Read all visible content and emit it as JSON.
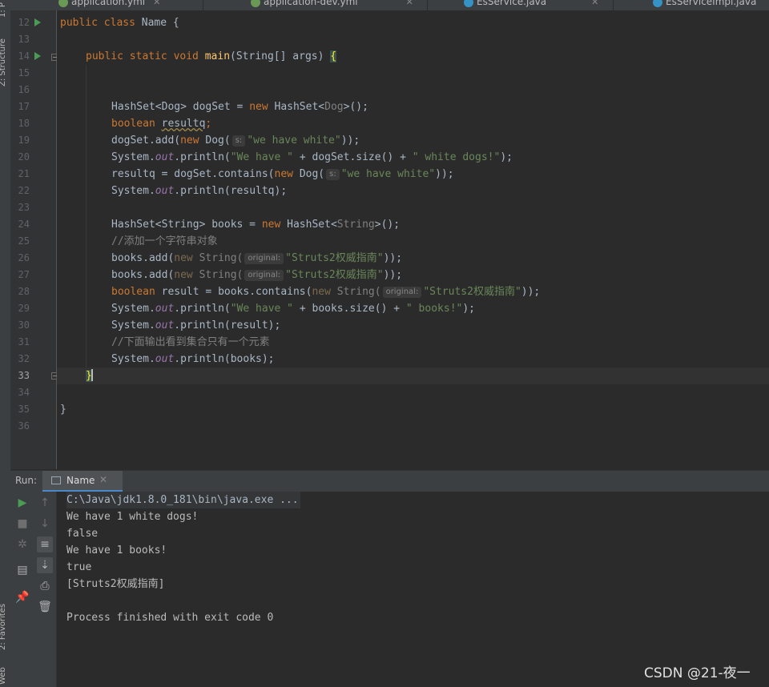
{
  "sidebar": {
    "project_label": "1: P",
    "structure_label": "Z: Structure",
    "favorites_label": "2: Favorites",
    "web_label": "Web"
  },
  "tabs": [
    {
      "label": "application.yml",
      "icon_color": "#6a9955"
    },
    {
      "label": "application-dev.yml",
      "icon_color": "#6a9955"
    },
    {
      "label": "EsService.java",
      "icon_color": "#3592c4"
    },
    {
      "label": "EsServiceImpl.java",
      "icon_color": "#3592c4"
    }
  ],
  "editor": {
    "line_numbers": [
      "12",
      "13",
      "14",
      "15",
      "16",
      "17",
      "18",
      "19",
      "20",
      "21",
      "22",
      "23",
      "24",
      "25",
      "26",
      "27",
      "28",
      "29",
      "30",
      "31",
      "32",
      "33",
      "34",
      "35",
      "36"
    ],
    "current_line": "33",
    "code": {
      "l12_kw": "public class ",
      "l12_rest": "Name {",
      "l14_kw": "public static void ",
      "l14_fn": "main",
      "l14_rest": "(String[] args) ",
      "l14_brace": "{",
      "l17_a": "HashSet<Dog> dogSet = ",
      "l17_kw": "new ",
      "l17_b": "HashSet<",
      "l17_gen": "Dog",
      "l17_c": ">();",
      "l18_kw": "boolean ",
      "l18_var": "resultq",
      "l18_end": ";",
      "l19_a": "dogSet.add(",
      "l19_kw": "new ",
      "l19_b": "Dog(",
      "l19_hint": "s:",
      "l19_str": "\"we have white\"",
      "l19_c": "));",
      "l20_a": "System.",
      "l20_out": "out",
      "l20_b": ".println(",
      "l20_s1": "\"We have \"",
      "l20_c": " + dogSet.size() + ",
      "l20_s2": "\" white dogs!\"",
      "l20_d": ");",
      "l21_a": "resultq = dogSet.contains(",
      "l21_kw": "new ",
      "l21_b": "Dog(",
      "l21_hint": "s:",
      "l21_str": "\"we have white\"",
      "l21_c": "));",
      "l22_a": "System.",
      "l22_out": "out",
      "l22_b": ".println(resultq);",
      "l24_a": "HashSet<String> books = ",
      "l24_kw": "new ",
      "l24_b": "HashSet<",
      "l24_gen": "String",
      "l24_c": ">();",
      "l25_cm": "//添加一个字符串对象",
      "l26_a": "books.add(",
      "l26_kw": "new ",
      "l26_b": "String(",
      "l26_hint": "original:",
      "l26_str": "\"Struts2权威指南\"",
      "l26_c": "));",
      "l27_a": "books.add(",
      "l27_kw": "new ",
      "l27_b": "String(",
      "l27_hint": "original:",
      "l27_str": "\"Struts2权威指南\"",
      "l27_c": "));",
      "l28_kw1": "boolean ",
      "l28_a": "result = books.contains(",
      "l28_kw2": "new ",
      "l28_b": "String(",
      "l28_hint": "original:",
      "l28_str": "\"Struts2权威指南\"",
      "l28_c": "));",
      "l29_a": "System.",
      "l29_out": "out",
      "l29_b": ".println(",
      "l29_s1": "\"We have \"",
      "l29_c": " + books.size() + ",
      "l29_s2": "\" books!\"",
      "l29_d": ");",
      "l30_a": "System.",
      "l30_out": "out",
      "l30_b": ".println(result);",
      "l31_cm": "//下面输出看到集合只有一个元素",
      "l32_a": "System.",
      "l32_out": "out",
      "l32_b": ".println(books);",
      "l33_brace": "}",
      "l35": "}"
    }
  },
  "run_panel": {
    "label": "Run:",
    "tab_name": "Name",
    "tab_close": "✕",
    "output": [
      "C:\\Java\\jdk1.8.0_181\\bin\\java.exe ...",
      "We have 1 white dogs!",
      "false",
      "We have 1 books!",
      "true",
      "[Struts2权威指南]",
      "",
      "Process finished with exit code 0"
    ]
  },
  "icons": {
    "rerun": "play-icon",
    "stop": "stop-icon",
    "up": "arrow-up-icon",
    "down": "arrow-down-icon",
    "wrap": "soft-wrap-icon",
    "scroll_end": "scroll-to-end-icon",
    "print": "print-icon",
    "trash": "trash-icon",
    "pin": "pin-icon",
    "layout": "layout-icon",
    "debug": "bug-icon"
  },
  "watermark": "CSDN @21-夜一"
}
